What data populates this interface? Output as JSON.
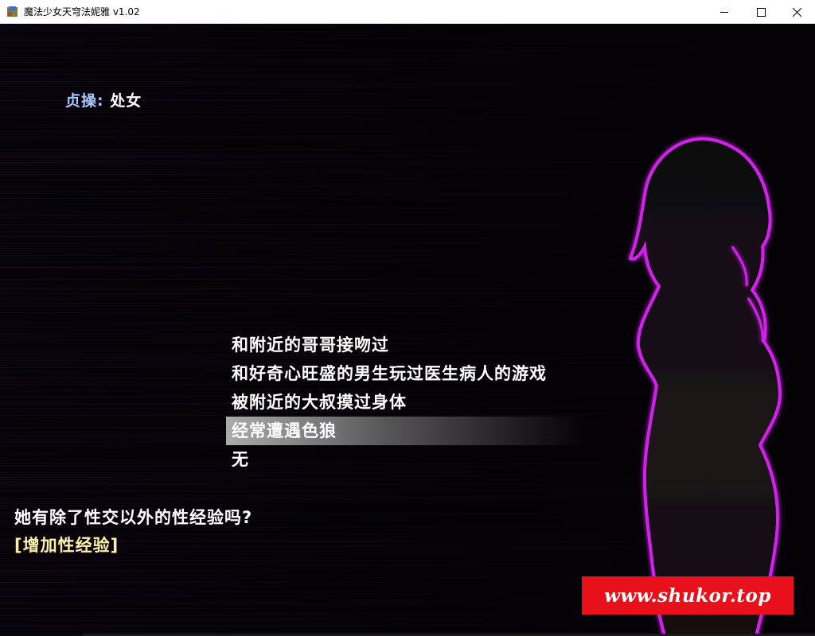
{
  "window": {
    "title": "魔法少女天穹法妮雅 v1.02",
    "icon": "app-game-icon",
    "controls": {
      "minimize": "minimize-icon",
      "maximize": "maximize-icon",
      "close": "close-icon"
    }
  },
  "status": {
    "label": "贞操",
    "separator": ":",
    "value": "处女"
  },
  "choices": [
    {
      "label": "和附近的哥哥接吻过",
      "selected": false
    },
    {
      "label": "和好奇心旺盛的男生玩过医生病人的游戏",
      "selected": false
    },
    {
      "label": "被附近的大叔摸过身体",
      "selected": false
    },
    {
      "label": "经常遭遇色狼",
      "selected": true
    },
    {
      "label": "无",
      "selected": false
    }
  ],
  "question": "她有除了性交以外的性经验吗?",
  "effect": "[增加性经验]",
  "watermark": "www.shukor.top",
  "colors": {
    "status_label": "#a8c8ff",
    "effect_text": "#fff2a8",
    "silhouette_glow": "#d020e8",
    "watermark_bg": "#e8101a",
    "scanline": "#5a2a6a"
  }
}
